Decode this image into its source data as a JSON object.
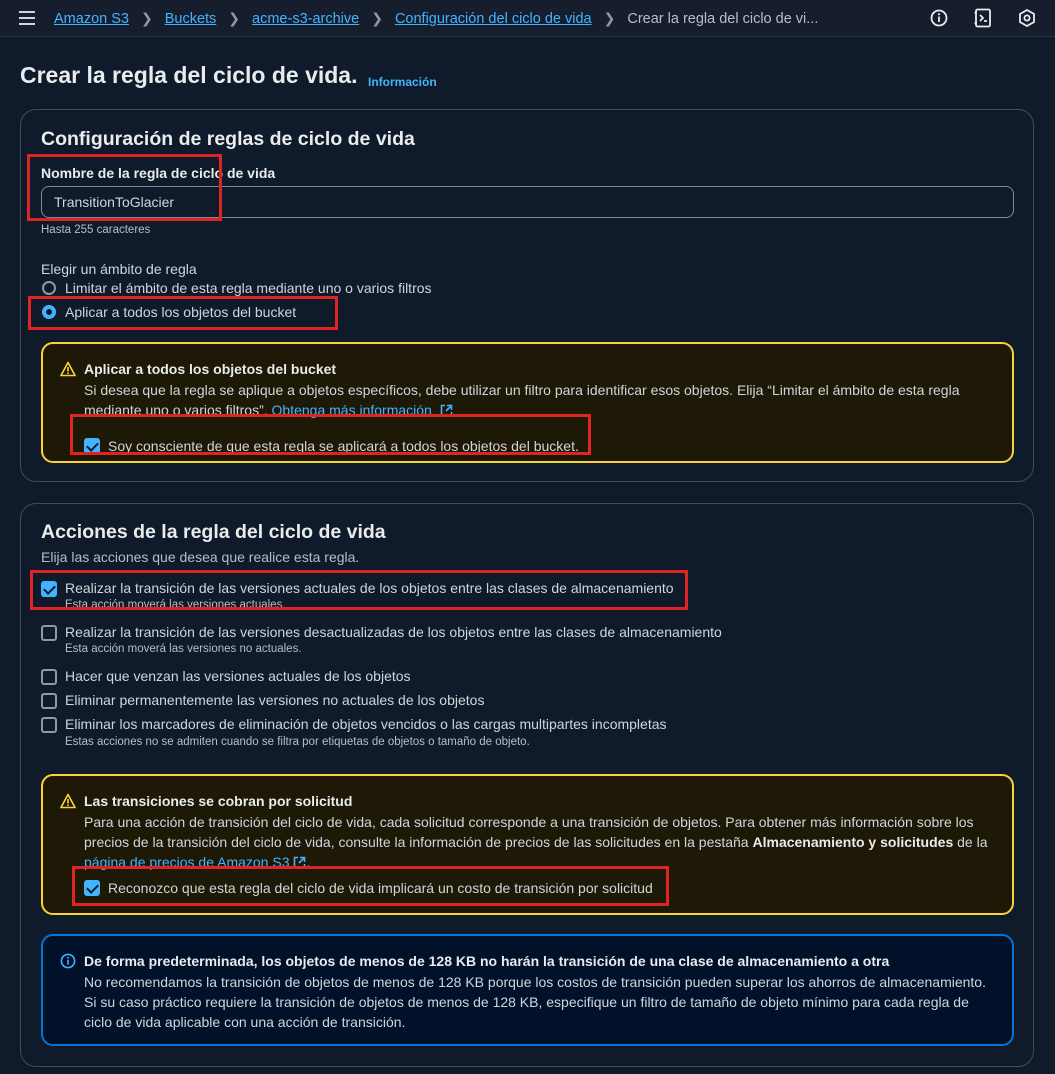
{
  "breadcrumbs": {
    "items": [
      "Amazon S3",
      "Buckets",
      "acme-s3-archive",
      "Configuración del ciclo de vida"
    ],
    "current": "Crear la regla del ciclo de vi..."
  },
  "top_icons": [
    "info-icon",
    "notes-icon",
    "settings-icon"
  ],
  "page": {
    "title": "Crear la regla del ciclo de vida.",
    "info_link": "Información"
  },
  "config_card": {
    "title": "Configuración de reglas de ciclo de vida",
    "name_label": "Nombre de la regla de ciclo de vida",
    "name_value": "TransitionToGlacier",
    "name_hint": "Hasta 255 caracteres",
    "scope_label": "Elegir un ámbito de regla",
    "scope_options": [
      {
        "label": "Limitar el ámbito de esta regla mediante uno o varios filtros",
        "selected": false
      },
      {
        "label": "Aplicar a todos los objetos del bucket",
        "selected": true
      }
    ],
    "warning": {
      "title": "Aplicar a todos los objetos del bucket",
      "body": "Si desea que la regla se aplique a objetos específicos, debe utilizar un filtro para identificar esos objetos. Elija “Limitar el ámbito de esta regla mediante uno o varios filtros”.",
      "link": "Obtenga más información",
      "ack_label": "Soy consciente de que esta regla se aplicará a todos los objetos del bucket.",
      "ack_checked": true
    }
  },
  "actions_card": {
    "title": "Acciones de la regla del ciclo de vida",
    "subtitle": "Elija las acciones que desea que realice esta regla.",
    "actions": [
      {
        "label": "Realizar la transición de las versiones actuales de los objetos entre las clases de almacenamiento",
        "desc": "Esta acción moverá las versiones actuales.",
        "checked": true
      },
      {
        "label": "Realizar la transición de las versiones desactualizadas de los objetos entre las clases de almacenamiento",
        "desc": "Esta acción moverá las versiones no actuales.",
        "checked": false
      },
      {
        "label": "Hacer que venzan las versiones actuales de los objetos",
        "desc": "",
        "checked": false
      },
      {
        "label": "Eliminar permanentemente las versiones no actuales de los objetos",
        "desc": "",
        "checked": false
      },
      {
        "label": "Eliminar los marcadores de eliminación de objetos vencidos o las cargas multipartes incompletas",
        "desc": "Estas acciones no se admiten cuando se filtra por etiquetas de objetos o tamaño de objeto.",
        "checked": false
      }
    ],
    "cost_warning": {
      "title": "Las transiciones se cobran por solicitud",
      "body_start": "Para una acción de transición del ciclo de vida, cada solicitud corresponde a una transición de objetos. Para obtener más información sobre los precios de la transición del ciclo de vida, consulte la información de precios de las solicitudes en la pestaña ",
      "body_bold": "Almacenamiento y solicitudes",
      "body_mid": " de la ",
      "link": "página de precios de Amazon S3",
      "body_end": ".",
      "ack_label": "Reconozco que esta regla del ciclo de vida implicará un costo de transición por solicitud",
      "ack_checked": true
    },
    "info_alert": {
      "title": "De forma predeterminada, los objetos de menos de 128 KB no harán la transición de una clase de almacenamiento a otra",
      "body": "No recomendamos la transición de objetos de menos de 128 KB porque los costos de transición pueden superar los ahorros de almacenamiento. Si su caso práctico requiere la transición de objetos de menos de 128 KB, especifique un filtro de tamaño de objeto mínimo para cada regla de ciclo de vida aplicable con una acción de transición."
    }
  },
  "colors": {
    "background": "#0f1b2a",
    "link": "#42b4ff",
    "warning_border": "#fbd332",
    "info_border": "#0972d3",
    "highlight": "#e02424"
  }
}
